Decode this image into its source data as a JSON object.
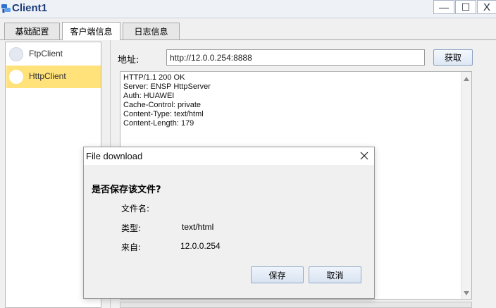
{
  "window": {
    "title": "Client1",
    "minimize_glyph": "—",
    "maximize_glyph": "☐",
    "close_glyph": "X"
  },
  "tabs": [
    {
      "label": "基础配置"
    },
    {
      "label": "客户端信息"
    },
    {
      "label": "日志信息"
    }
  ],
  "clients": [
    {
      "label": "FtpClient"
    },
    {
      "label": "HttpClient"
    }
  ],
  "address": {
    "label": "地址:",
    "value": "http://12.0.0.254:8888",
    "fetch_label": "获取"
  },
  "response": {
    "lines": [
      "HTTP/1.1 200 OK",
      "Server: ENSP HttpServer",
      "Auth: HUAWEI",
      "Cache-Control: private",
      "Content-Type: text/html",
      "Content-Length: 179"
    ]
  },
  "dialog": {
    "title": "File download",
    "question": "是否保存该文件?",
    "filename_label": "文件名:",
    "filename_value": "",
    "type_label": "类型:",
    "type_value": "text/html",
    "from_label": "来自:",
    "from_value": "12.0.0.254",
    "save_label": "保存",
    "cancel_label": "取消"
  },
  "colors": {
    "selected_item": "#ffe27a",
    "title_text": "#1d3b7a",
    "button_border": "#8aa2c2"
  },
  "icons": {
    "app": "network-client-icon",
    "dialog_close": "close-icon"
  }
}
